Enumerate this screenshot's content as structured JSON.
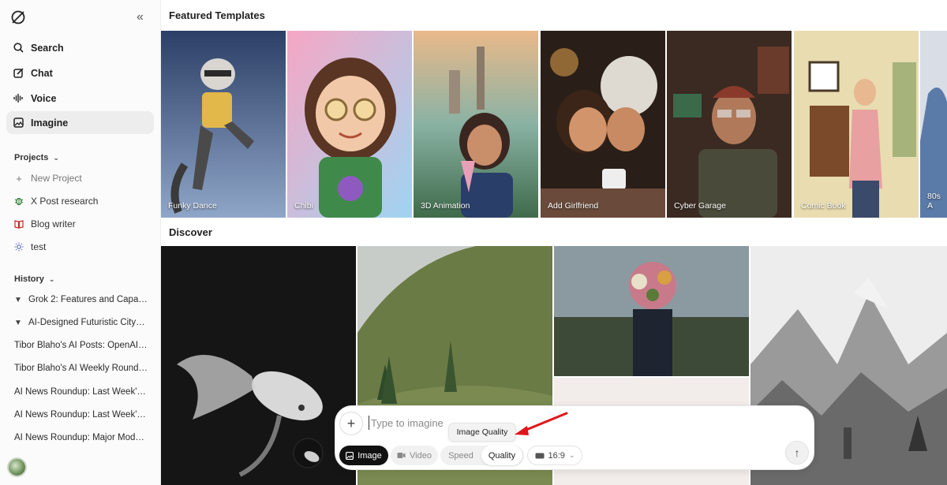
{
  "sidebar": {
    "nav": [
      {
        "label": "Search",
        "icon": "search-icon"
      },
      {
        "label": "Chat",
        "icon": "chat-edit-icon"
      },
      {
        "label": "Voice",
        "icon": "voice-wave-icon"
      },
      {
        "label": "Imagine",
        "icon": "image-icon",
        "active": true
      }
    ],
    "projects": {
      "heading": "Projects",
      "items": [
        {
          "label": "New Project",
          "icon": "plus-icon"
        },
        {
          "label": "X Post research",
          "icon": "bug-icon"
        },
        {
          "label": "Blog writer",
          "icon": "book-icon"
        },
        {
          "label": "test",
          "icon": "sun-icon"
        }
      ]
    },
    "history": {
      "heading": "History",
      "items": [
        {
          "label": "Grok 2: Features and Capa…",
          "pinned": true
        },
        {
          "label": "AI-Designed Futuristic City…",
          "pinned": true
        },
        {
          "label": "Tibor Blaho's AI Posts: OpenAI …",
          "pinned": false
        },
        {
          "label": "Tibor Blaho's AI Weekly Roundu…",
          "pinned": false
        },
        {
          "label": "AI News Roundup: Last Week's …",
          "pinned": false
        },
        {
          "label": "AI News Roundup: Last Week's …",
          "pinned": false
        },
        {
          "label": "AI News Roundup: Major Model…",
          "pinned": false
        }
      ]
    }
  },
  "main": {
    "featured_title": "Featured Templates",
    "templates": [
      {
        "label": "Funky Dance"
      },
      {
        "label": "Chibi"
      },
      {
        "label": "3D Animation"
      },
      {
        "label": "Add Girlfriend"
      },
      {
        "label": "Cyber Garage"
      },
      {
        "label": "Comic Book"
      },
      {
        "label": "80s A"
      }
    ],
    "discover_title": "Discover"
  },
  "composer": {
    "placeholder": "Type to imagine",
    "tooltip": "Image Quality",
    "image_label": "Image",
    "video_label": "Video",
    "speed_label": "Speed",
    "quality_label": "Quality",
    "ratio_label": "16:9"
  },
  "colors": {
    "accent_dark": "#111111",
    "annotation_arrow": "#e0161b",
    "active_nav_bg": "#ededed"
  }
}
